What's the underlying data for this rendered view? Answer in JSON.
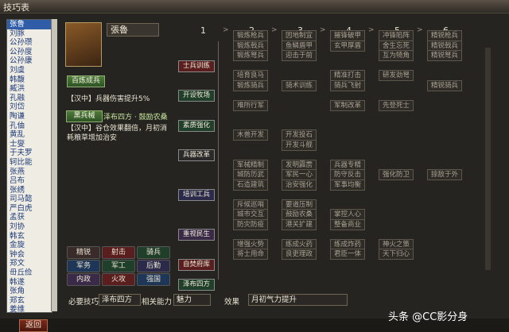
{
  "window": {
    "title": "技巧表"
  },
  "officers": [
    "张鲁",
    "刘豚",
    "公孙瓒",
    "公孙度",
    "公孙康",
    "刘虞",
    "韩馥",
    "臧洪",
    "孔融",
    "刘岱",
    "陶谦",
    "孔伷",
    "黄乱",
    "士燮",
    "于夫罗",
    "轲比能",
    "张燕",
    "吕布",
    "张绣",
    "司马懿",
    "严白虎",
    "孟获",
    "刘协",
    "韩玄",
    "金旋",
    "钟会",
    "郑文",
    "毌丘俭",
    "韩遂",
    "张角",
    "郑玄",
    "姜维"
  ],
  "selected_officer": "张鲁",
  "character": {
    "name": "張魯"
  },
  "skill1": {
    "button": "百炼成兵",
    "desc": "【汉中】兵器伤害提升5%"
  },
  "skill2": {
    "button": "黑兵械",
    "name": "泽布四方 · 鼓励农桑",
    "desc": "【汉中】谷仓效果翻倍，月初消耗粮草增加治安"
  },
  "categories": [
    {
      "label": "精锐",
      "color": "#3a2b2b"
    },
    {
      "label": "射击",
      "color": "#5a1e1e"
    },
    {
      "label": "骑兵",
      "color": "#1f3f2a"
    },
    {
      "label": "军务",
      "color": "#1e3658"
    },
    {
      "label": "军工",
      "color": "#1f3f2a"
    },
    {
      "label": "后勤",
      "color": "#2b2a4a"
    },
    {
      "label": "内政",
      "color": "#3a2a48"
    },
    {
      "label": "火攻",
      "color": "#5a1e1e"
    },
    {
      "label": "强国",
      "color": "#1e3658"
    }
  ],
  "tree": {
    "columns": [
      "1",
      "2",
      "3",
      "4",
      "5",
      "6"
    ],
    "arrow": ">",
    "groups": [
      {
        "label": "士兵训练",
        "color": "#5a1e1e",
        "row": 4
      },
      {
        "label": "开设牧场",
        "color": "#1f3f2a",
        "row": 7
      },
      {
        "label": "素质强化",
        "color": "#1f3f2a",
        "row": 10
      },
      {
        "label": "兵器改革",
        "color": "#2a2a2a",
        "row": 13
      },
      {
        "label": "培训工兵",
        "color": "#2b2a4a",
        "row": 17
      },
      {
        "label": "重视民生",
        "color": "#3a2a48",
        "row": 21
      },
      {
        "label": "自焚府库",
        "color": "#5a1e1e",
        "row": 24
      },
      {
        "label": "泽布四方",
        "color": "#1f3f2a",
        "row": 26
      }
    ],
    "nodes": [
      {
        "label": "锻炼枪兵",
        "col": 2,
        "row": 1
      },
      {
        "label": "因地制宜",
        "col": 3,
        "row": 1
      },
      {
        "label": "摧锋破甲",
        "col": 4,
        "row": 1
      },
      {
        "label": "冲锋陷阵",
        "col": 5,
        "row": 1
      },
      {
        "label": "精锐枪兵",
        "col": 6,
        "row": 1
      },
      {
        "label": "锻炼戟兵",
        "col": 2,
        "row": 2
      },
      {
        "label": "鱼鳞盾甲",
        "col": 3,
        "row": 2
      },
      {
        "label": "玄甲厚盾",
        "col": 4,
        "row": 2
      },
      {
        "label": "舍生忘死",
        "col": 5,
        "row": 2
      },
      {
        "label": "精锐戟兵",
        "col": 6,
        "row": 2
      },
      {
        "label": "锻炼弩兵",
        "col": 2,
        "row": 3
      },
      {
        "label": "迎击于前",
        "col": 3,
        "row": 3
      },
      {
        "label": "互为犄角",
        "col": 5,
        "row": 3
      },
      {
        "label": "精锐弩兵",
        "col": 6,
        "row": 3
      },
      {
        "label": "培育良马",
        "col": 2,
        "row": 5
      },
      {
        "label": "精准打击",
        "col": 4,
        "row": 5
      },
      {
        "label": "研发劲弩",
        "col": 5,
        "row": 5
      },
      {
        "label": "锻炼骑兵",
        "col": 2,
        "row": 6
      },
      {
        "label": "骑术训练",
        "col": 3,
        "row": 6
      },
      {
        "label": "骑兵飞射",
        "col": 4,
        "row": 6
      },
      {
        "label": "精锐骑兵",
        "col": 6,
        "row": 6
      },
      {
        "label": "难所行军",
        "col": 2,
        "row": 8
      },
      {
        "label": "军制改革",
        "col": 4,
        "row": 8
      },
      {
        "label": "先登死士",
        "col": 5,
        "row": 8
      },
      {
        "label": "木兽开发",
        "col": 2,
        "row": 11
      },
      {
        "label": "开发投石",
        "col": 3,
        "row": 11
      },
      {
        "label": "开发斗舰",
        "col": 3,
        "row": 12
      },
      {
        "label": "军械精制",
        "col": 2,
        "row": 14
      },
      {
        "label": "发明霹雳",
        "col": 3,
        "row": 14
      },
      {
        "label": "兵器专精",
        "col": 4,
        "row": 14
      },
      {
        "label": "城防历武",
        "col": 2,
        "row": 15
      },
      {
        "label": "军民一心",
        "col": 3,
        "row": 15
      },
      {
        "label": "防守反击",
        "col": 4,
        "row": 15
      },
      {
        "label": "强化防卫",
        "col": 5,
        "row": 15
      },
      {
        "label": "掠敌于外",
        "col": 6,
        "row": 15
      },
      {
        "label": "石造建筑",
        "col": 2,
        "row": 16
      },
      {
        "label": "治安强化",
        "col": 3,
        "row": 16
      },
      {
        "label": "军事均衡",
        "col": 4,
        "row": 16
      },
      {
        "label": "斥候巡哨",
        "col": 2,
        "row": 18
      },
      {
        "label": "要道压制",
        "col": 3,
        "row": 18
      },
      {
        "label": "城市交互",
        "col": 2,
        "row": 19
      },
      {
        "label": "鼓励农桑",
        "col": 3,
        "row": 19
      },
      {
        "label": "掌控人心",
        "col": 4,
        "row": 19
      },
      {
        "label": "防灾防疫",
        "col": 2,
        "row": 20
      },
      {
        "label": "港关扩建",
        "col": 3,
        "row": 20
      },
      {
        "label": "整备商业",
        "col": 4,
        "row": 20
      },
      {
        "label": "增强火势",
        "col": 2,
        "row": 22
      },
      {
        "label": "练成火药",
        "col": 3,
        "row": 22
      },
      {
        "label": "练成炸药",
        "col": 4,
        "row": 22
      },
      {
        "label": "神火之策",
        "col": 5,
        "row": 22
      },
      {
        "label": "将士用命",
        "col": 2,
        "row": 23
      },
      {
        "label": "良吏理政",
        "col": 3,
        "row": 23
      },
      {
        "label": "君臣一体",
        "col": 4,
        "row": 23
      },
      {
        "label": "天下归心",
        "col": 5,
        "row": 23
      }
    ]
  },
  "footer": {
    "req_label": "必要技巧",
    "req_value": "泽布四方",
    "ability_label": "相关能力",
    "ability_value": "魅力",
    "effect_label": "效果",
    "effect_value": "月初气力提升",
    "back": "返回"
  },
  "watermark": "头条 @CC影分身"
}
